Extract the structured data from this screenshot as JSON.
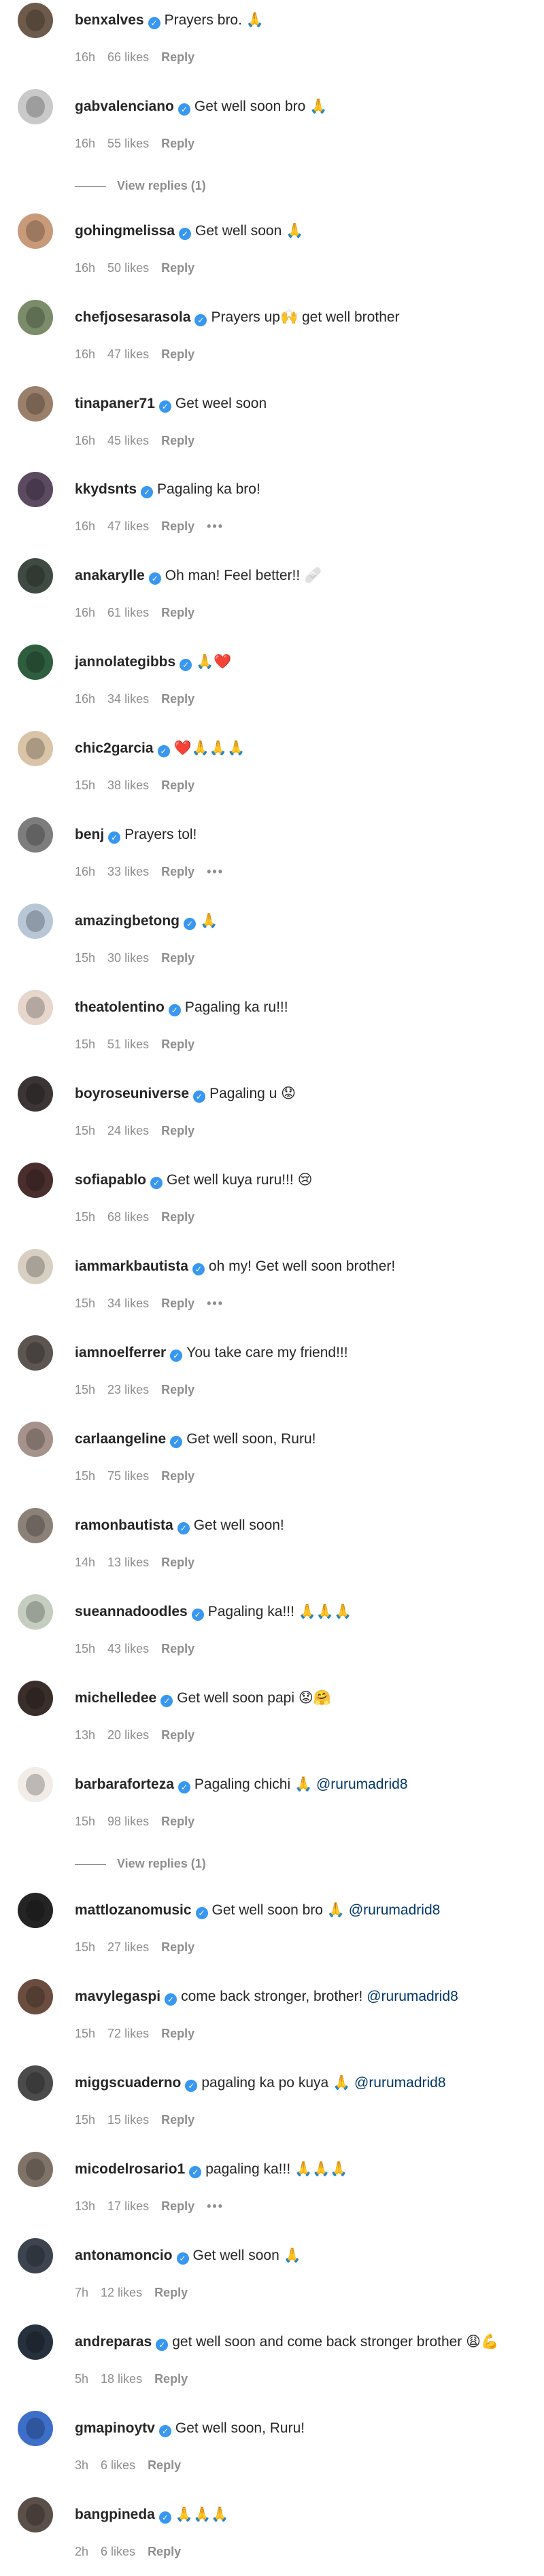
{
  "comments": [
    {
      "username": "benxalves",
      "verified": true,
      "text": "Prayers bro. 🙏",
      "time": "16h",
      "likes": "66 likes",
      "reply": "Reply",
      "more": false,
      "avatar_color": "#6d5a4b"
    },
    {
      "username": "gabvalenciano",
      "verified": true,
      "text": "Get well soon bro 🙏",
      "time": "16h",
      "likes": "55 likes",
      "reply": "Reply",
      "more": false,
      "avatar_color": "#c9c9c9",
      "view_replies": "View replies (1)"
    },
    {
      "username": "gohingmelissa",
      "verified": true,
      "text": "Get well soon 🙏",
      "time": "16h",
      "likes": "50 likes",
      "reply": "Reply",
      "more": false,
      "avatar_color": "#c89a7a"
    },
    {
      "username": "chefjosesarasola",
      "verified": true,
      "text": "Prayers up🙌 get well brother",
      "time": "16h",
      "likes": "47 likes",
      "reply": "Reply",
      "more": false,
      "avatar_color": "#7a8c6a"
    },
    {
      "username": "tinapaner71",
      "verified": true,
      "text": "Get weel soon",
      "time": "16h",
      "likes": "45 likes",
      "reply": "Reply",
      "more": false,
      "avatar_color": "#9a7f6b"
    },
    {
      "username": "kkydsnts",
      "verified": true,
      "text": "Pagaling ka bro!",
      "time": "16h",
      "likes": "47 likes",
      "reply": "Reply",
      "more": true,
      "avatar_color": "#5b4a60"
    },
    {
      "username": "anakarylle",
      "verified": true,
      "text": "Oh man! Feel better!! 🩹",
      "time": "16h",
      "likes": "61 likes",
      "reply": "Reply",
      "more": false,
      "avatar_color": "#3f4a42"
    },
    {
      "username": "jannolategibbs",
      "verified": true,
      "text": "🙏❤️",
      "time": "16h",
      "likes": "34 likes",
      "reply": "Reply",
      "more": false,
      "avatar_color": "#2f5e3e"
    },
    {
      "username": "chic2garcia",
      "verified": true,
      "text": "❤️🙏🙏🙏",
      "time": "15h",
      "likes": "38 likes",
      "reply": "Reply",
      "more": false,
      "avatar_color": "#d9c4a8"
    },
    {
      "username": "benj",
      "verified": true,
      "text": "Prayers tol!",
      "time": "16h",
      "likes": "33 likes",
      "reply": "Reply",
      "more": true,
      "avatar_color": "#7d7d7d"
    },
    {
      "username": "amazingbetong",
      "verified": true,
      "text": "🙏",
      "time": "15h",
      "likes": "30 likes",
      "reply": "Reply",
      "more": false,
      "avatar_color": "#b7c7d6"
    },
    {
      "username": "theatolentino",
      "verified": true,
      "text": "Pagaling ka ru!!!",
      "time": "15h",
      "likes": "51 likes",
      "reply": "Reply",
      "more": false,
      "avatar_color": "#e6d6cc"
    },
    {
      "username": "boyroseuniverse",
      "verified": true,
      "text": "Pagaling u 😟",
      "time": "15h",
      "likes": "24 likes",
      "reply": "Reply",
      "more": false,
      "avatar_color": "#3b3535"
    },
    {
      "username": "sofiapablo",
      "verified": true,
      "text": "Get well kuya ruru!!! 😢",
      "time": "15h",
      "likes": "68 likes",
      "reply": "Reply",
      "more": false,
      "avatar_color": "#4a2d2d"
    },
    {
      "username": "iammarkbautista",
      "verified": true,
      "text": "oh my! Get well soon brother!",
      "time": "15h",
      "likes": "34 likes",
      "reply": "Reply",
      "more": true,
      "avatar_color": "#d8cfc3"
    },
    {
      "username": "iamnoelferrer",
      "verified": true,
      "text": "You take care my friend!!!",
      "time": "15h",
      "likes": "23 likes",
      "reply": "Reply",
      "more": false,
      "avatar_color": "#5c5552"
    },
    {
      "username": "carlaangeline",
      "verified": true,
      "text": "Get well soon, Ruru!",
      "time": "15h",
      "likes": "75 likes",
      "reply": "Reply",
      "more": false,
      "avatar_color": "#a5928a"
    },
    {
      "username": "ramonbautista",
      "verified": true,
      "text": "Get well soon!",
      "time": "14h",
      "likes": "13 likes",
      "reply": "Reply",
      "more": false,
      "avatar_color": "#8b8178"
    },
    {
      "username": "sueannadoodles",
      "verified": true,
      "text": "Pagaling ka!!! 🙏🙏🙏",
      "time": "15h",
      "likes": "43 likes",
      "reply": "Reply",
      "more": false,
      "avatar_color": "#c4cdc0"
    },
    {
      "username": "michelledee",
      "verified": true,
      "text": "Get well soon papi 😟🤗",
      "time": "13h",
      "likes": "20 likes",
      "reply": "Reply",
      "more": false,
      "avatar_color": "#3a2e2b"
    },
    {
      "username": "barbaraforteza",
      "verified": true,
      "text": "Pagaling chichi 🙏 ",
      "mention": "@rurumadrid8",
      "time": "15h",
      "likes": "98 likes",
      "reply": "Reply",
      "more": false,
      "avatar_color": "#f1ece8",
      "view_replies": "View replies (1)"
    },
    {
      "username": "mattlozanomusic",
      "verified": true,
      "text": "Get well soon bro 🙏 ",
      "mention": "@rurumadrid8",
      "time": "15h",
      "likes": "27 likes",
      "reply": "Reply",
      "more": false,
      "avatar_color": "#242424"
    },
    {
      "username": "mavylegaspi",
      "verified": true,
      "text": "come back stronger, brother! ",
      "mention": "@rurumadrid8",
      "time": "15h",
      "likes": "72 likes",
      "reply": "Reply",
      "more": false,
      "avatar_color": "#6b4d3f"
    },
    {
      "username": "miggscuaderno",
      "verified": true,
      "text": "pagaling ka po kuya 🙏 ",
      "mention": "@rurumadrid8",
      "time": "15h",
      "likes": "15 likes",
      "reply": "Reply",
      "more": false,
      "avatar_color": "#4b4b4b"
    },
    {
      "username": "micodelrosario1",
      "verified": true,
      "text": "pagaling ka!!! 🙏🙏🙏",
      "time": "13h",
      "likes": "17 likes",
      "reply": "Reply",
      "more": true,
      "avatar_color": "#7f7368"
    },
    {
      "username": "antonamoncio",
      "verified": true,
      "text": "Get well soon 🙏",
      "time": "7h",
      "likes": "12 likes",
      "reply": "Reply",
      "more": false,
      "avatar_color": "#3d4450"
    },
    {
      "username": "andreparas",
      "verified": true,
      "text": "get well soon and come back stronger brother 😩💪",
      "time": "5h",
      "likes": "18 likes",
      "reply": "Reply",
      "more": false,
      "avatar_color": "#26313d"
    },
    {
      "username": "gmapinoytv",
      "verified": true,
      "text": "Get well soon, Ruru!",
      "time": "3h",
      "likes": "6 likes",
      "reply": "Reply",
      "more": false,
      "avatar_color": "#3d6fc9"
    },
    {
      "username": "bangpineda",
      "verified": true,
      "text": "🙏🙏🙏",
      "time": "2h",
      "likes": "6 likes",
      "reply": "Reply",
      "more": false,
      "avatar_color": "#5a4f49"
    }
  ],
  "more_icon": "more-options-icon",
  "verified_icon": "verified-badge-icon",
  "colors": {
    "verified": "#3897f0",
    "meta": "#8e8e8e",
    "mention": "#00376b"
  }
}
